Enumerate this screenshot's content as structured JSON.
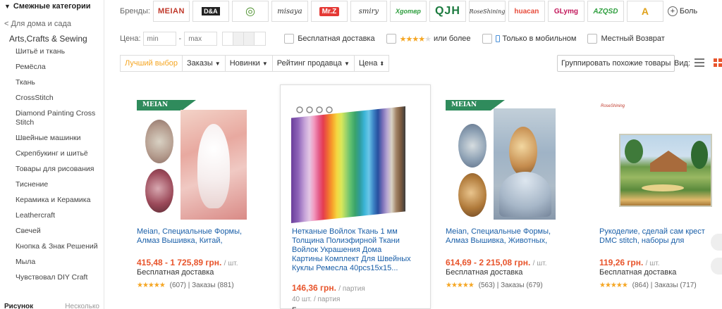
{
  "sidebar": {
    "heading": "Смежные категории",
    "back": "< Для дома и сада",
    "current": "Arts,Crafts & Sewing",
    "items": [
      "Шитьё и ткань",
      "Ремёсла",
      "Ткань",
      "CrossStitch",
      "Diamond Painting Cross Stitch",
      "Швейные машинки",
      "Скрепбукинг и шитьё",
      "Товары для рисования",
      "Тиснение",
      "Керамика и Керамика",
      "Leathercraft",
      "Свечей",
      "Кнопка & Знак Решений",
      "Мыла",
      "Чувствовал DIY Craft"
    ],
    "footer_left": "Рисунок",
    "footer_right": "Несколько"
  },
  "brands": {
    "label": "Бренды:",
    "items": [
      "MEIAN",
      "D&A",
      "",
      "misaya",
      "Mr.Z",
      "smiry",
      "Хgoтвр",
      "QJH",
      "RoseShining",
      "huacan",
      "GLymg",
      "AZQSD",
      "A"
    ],
    "more": "Боль"
  },
  "filters": {
    "price_label": "Цена:",
    "min_placeholder": "min",
    "max_placeholder": "max",
    "dash": "-",
    "free_shipping": "Бесплатная доставка",
    "rating_more": "или более",
    "mobile_only": "Только в мобильном",
    "local_return": "Местный Возврат"
  },
  "sort": {
    "best": "Лучший выбор",
    "orders": "Заказы",
    "new": "Новинки",
    "seller_rating": "Рейтинг продавца",
    "price": "Цена",
    "group_similar": "Группировать похожие товары",
    "view_label": "Вид:"
  },
  "products": [
    {
      "badge": "MEIAN",
      "title": "Meian, Специальные Формы, Алмаз Вышивка, Китай,",
      "price": "415,48 - 1 725,89 грн.",
      "unit": "/ шт.",
      "shipping": "Бесплатная доставка",
      "reviews": "(607)",
      "orders": "Заказы (881)"
    },
    {
      "badge": "",
      "title": "Нетканые Войлок Ткань 1 мм Толщина Полиэфирной Ткани Войлок Украшения Дома Картины Комплект Для Швейных Куклы Ремесла 40pcs15x15...",
      "price": "146,36 грн.",
      "unit": "/ партия",
      "sub": "40 шт. / партия",
      "shipping": "Б",
      "reviews": "",
      "orders": ""
    },
    {
      "badge": "MEIAN",
      "title": "Meian, Специальные Формы, Алмаз Вышивка, Животных,",
      "price": "614,69 - 2 215,08 грн.",
      "unit": "/ шт.",
      "shipping": "Бесплатная доставка",
      "reviews": "(563)",
      "orders": "Заказы (679)"
    },
    {
      "badge": "",
      "title": "Рукоделие, сделай сам крест DMC stitch, наборы для",
      "price": "119,26 грн.",
      "unit": "/ шт.",
      "shipping": "Бесплатная доставка",
      "reviews": "(864)",
      "orders": "Заказы (717)"
    }
  ],
  "colors": {
    "accent": "#e8542b",
    "link": "#1a5fa8",
    "star": "#f5a623",
    "active_sort": "#f5a623"
  }
}
